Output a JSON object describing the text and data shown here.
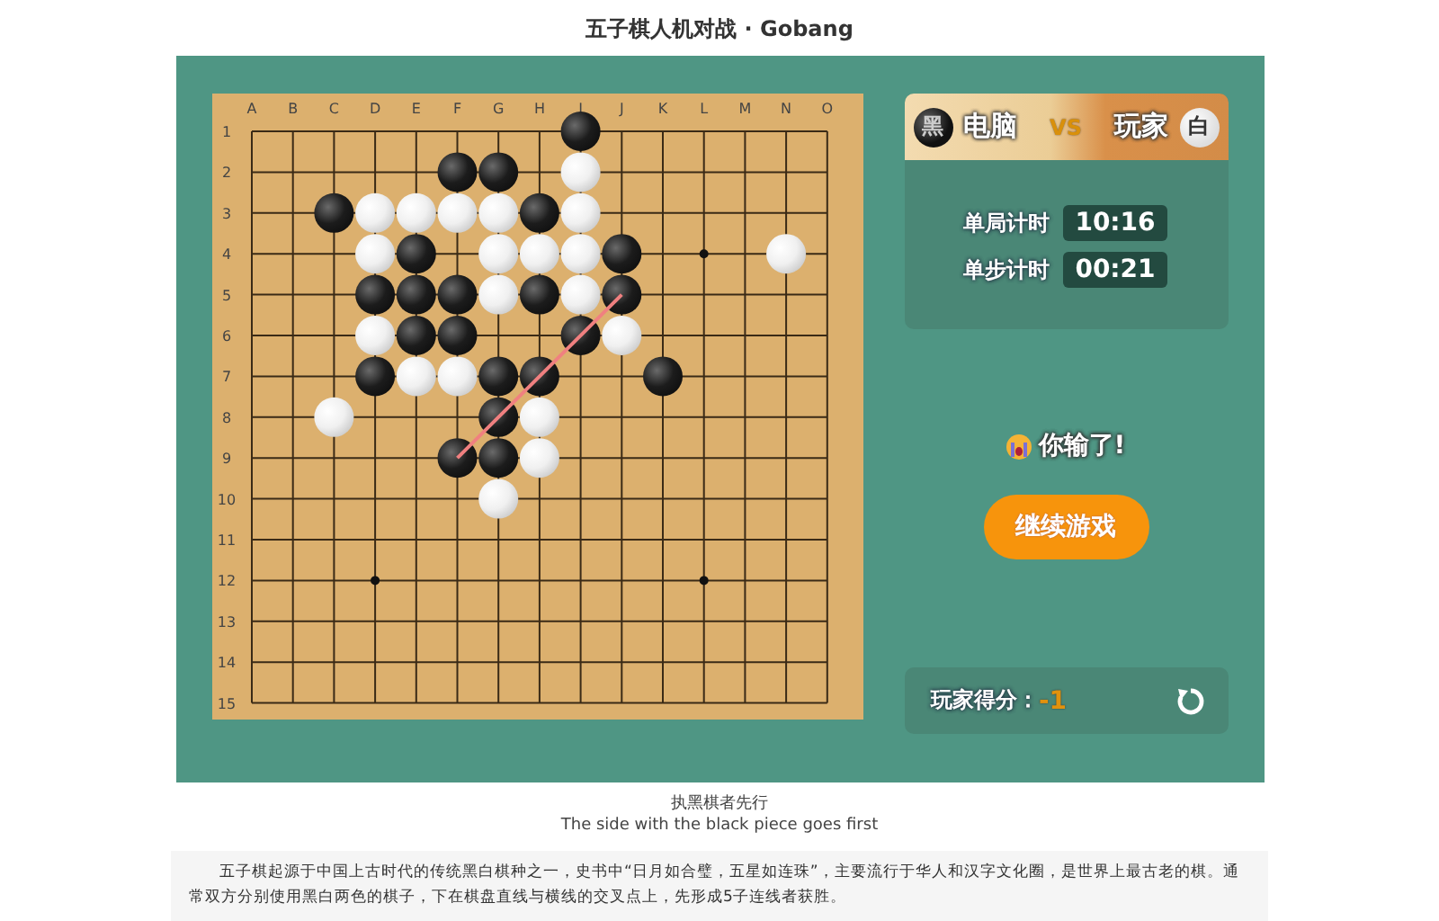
{
  "page_title": "五子棋人机对战 · Gobang",
  "board": {
    "columns": [
      "A",
      "B",
      "C",
      "D",
      "E",
      "F",
      "G",
      "H",
      "I",
      "J",
      "K",
      "L",
      "M",
      "N",
      "O"
    ],
    "rows": [
      "1",
      "2",
      "3",
      "4",
      "5",
      "6",
      "7",
      "8",
      "9",
      "10",
      "11",
      "12",
      "13",
      "14",
      "15"
    ],
    "grid": [
      [
        {
          "kind": "empty"
        },
        {
          "kind": "empty"
        },
        {
          "kind": "empty"
        },
        {
          "kind": "empty"
        },
        {
          "kind": "empty"
        },
        {
          "kind": "empty"
        },
        {
          "kind": "empty"
        },
        {
          "kind": "empty"
        },
        {
          "kind": "black"
        },
        {
          "kind": "empty"
        },
        {
          "kind": "empty"
        },
        {
          "kind": "empty"
        },
        {
          "kind": "empty"
        },
        {
          "kind": "empty"
        },
        {
          "kind": "empty"
        }
      ],
      [
        {
          "kind": "empty"
        },
        {
          "kind": "empty"
        },
        {
          "kind": "empty"
        },
        {
          "kind": "empty"
        },
        {
          "kind": "empty"
        },
        {
          "kind": "black"
        },
        {
          "kind": "black"
        },
        {
          "kind": "empty"
        },
        {
          "kind": "white"
        },
        {
          "kind": "empty"
        },
        {
          "kind": "empty"
        },
        {
          "kind": "empty"
        },
        {
          "kind": "empty"
        },
        {
          "kind": "empty"
        },
        {
          "kind": "empty"
        }
      ],
      [
        {
          "kind": "empty"
        },
        {
          "kind": "empty"
        },
        {
          "kind": "black"
        },
        {
          "kind": "white"
        },
        {
          "kind": "white"
        },
        {
          "kind": "white"
        },
        {
          "kind": "white"
        },
        {
          "kind": "black"
        },
        {
          "kind": "white"
        },
        {
          "kind": "empty"
        },
        {
          "kind": "empty"
        },
        {
          "kind": "empty"
        },
        {
          "kind": "empty"
        },
        {
          "kind": "empty"
        },
        {
          "kind": "empty"
        }
      ],
      [
        {
          "kind": "empty"
        },
        {
          "kind": "empty"
        },
        {
          "kind": "empty"
        },
        {
          "kind": "white"
        },
        {
          "kind": "black"
        },
        {
          "kind": "empty"
        },
        {
          "kind": "white"
        },
        {
          "kind": "white"
        },
        {
          "kind": "white"
        },
        {
          "kind": "black"
        },
        {
          "kind": "empty"
        },
        {
          "kind": "empty"
        },
        {
          "kind": "empty"
        },
        {
          "kind": "white"
        },
        {
          "kind": "empty"
        }
      ],
      [
        {
          "kind": "empty"
        },
        {
          "kind": "empty"
        },
        {
          "kind": "empty"
        },
        {
          "kind": "black"
        },
        {
          "kind": "black"
        },
        {
          "kind": "black"
        },
        {
          "kind": "white"
        },
        {
          "kind": "black"
        },
        {
          "kind": "white"
        },
        {
          "kind": "black",
          "winning": true
        },
        {
          "kind": "empty"
        },
        {
          "kind": "empty"
        },
        {
          "kind": "empty"
        },
        {
          "kind": "empty"
        },
        {
          "kind": "empty"
        }
      ],
      [
        {
          "kind": "empty"
        },
        {
          "kind": "empty"
        },
        {
          "kind": "empty"
        },
        {
          "kind": "white"
        },
        {
          "kind": "black"
        },
        {
          "kind": "black"
        },
        {
          "kind": "empty"
        },
        {
          "kind": "empty"
        },
        {
          "kind": "black",
          "winning": true
        },
        {
          "kind": "white"
        },
        {
          "kind": "empty"
        },
        {
          "kind": "empty"
        },
        {
          "kind": "empty"
        },
        {
          "kind": "empty"
        },
        {
          "kind": "empty"
        }
      ],
      [
        {
          "kind": "empty"
        },
        {
          "kind": "empty"
        },
        {
          "kind": "empty"
        },
        {
          "kind": "black"
        },
        {
          "kind": "white"
        },
        {
          "kind": "white"
        },
        {
          "kind": "black"
        },
        {
          "kind": "black",
          "winning": true
        },
        {
          "kind": "empty"
        },
        {
          "kind": "empty"
        },
        {
          "kind": "black"
        },
        {
          "kind": "empty"
        },
        {
          "kind": "empty"
        },
        {
          "kind": "empty"
        },
        {
          "kind": "empty"
        }
      ],
      [
        {
          "kind": "empty"
        },
        {
          "kind": "empty"
        },
        {
          "kind": "white"
        },
        {
          "kind": "empty"
        },
        {
          "kind": "empty"
        },
        {
          "kind": "empty"
        },
        {
          "kind": "black",
          "winning": true
        },
        {
          "kind": "white"
        },
        {
          "kind": "empty"
        },
        {
          "kind": "empty"
        },
        {
          "kind": "empty"
        },
        {
          "kind": "empty"
        },
        {
          "kind": "empty"
        },
        {
          "kind": "empty"
        },
        {
          "kind": "empty"
        }
      ],
      [
        {
          "kind": "empty"
        },
        {
          "kind": "empty"
        },
        {
          "kind": "empty"
        },
        {
          "kind": "empty"
        },
        {
          "kind": "empty"
        },
        {
          "kind": "black",
          "winning": true
        },
        {
          "kind": "black"
        },
        {
          "kind": "white"
        },
        {
          "kind": "empty"
        },
        {
          "kind": "empty"
        },
        {
          "kind": "empty"
        },
        {
          "kind": "empty"
        },
        {
          "kind": "empty"
        },
        {
          "kind": "empty"
        },
        {
          "kind": "empty"
        }
      ],
      [
        {
          "kind": "empty"
        },
        {
          "kind": "empty"
        },
        {
          "kind": "empty"
        },
        {
          "kind": "empty"
        },
        {
          "kind": "empty"
        },
        {
          "kind": "empty"
        },
        {
          "kind": "white"
        },
        {
          "kind": "empty"
        },
        {
          "kind": "empty"
        },
        {
          "kind": "empty"
        },
        {
          "kind": "empty"
        },
        {
          "kind": "empty"
        },
        {
          "kind": "empty"
        },
        {
          "kind": "empty"
        },
        {
          "kind": "empty"
        }
      ],
      [
        {
          "kind": "empty"
        },
        {
          "kind": "empty"
        },
        {
          "kind": "empty"
        },
        {
          "kind": "empty"
        },
        {
          "kind": "empty"
        },
        {
          "kind": "empty"
        },
        {
          "kind": "empty"
        },
        {
          "kind": "empty"
        },
        {
          "kind": "empty"
        },
        {
          "kind": "empty"
        },
        {
          "kind": "empty"
        },
        {
          "kind": "empty"
        },
        {
          "kind": "empty"
        },
        {
          "kind": "empty"
        },
        {
          "kind": "empty"
        }
      ],
      [
        {
          "kind": "empty"
        },
        {
          "kind": "empty"
        },
        {
          "kind": "empty"
        },
        {
          "kind": "empty"
        },
        {
          "kind": "empty"
        },
        {
          "kind": "empty"
        },
        {
          "kind": "empty"
        },
        {
          "kind": "empty"
        },
        {
          "kind": "empty"
        },
        {
          "kind": "empty"
        },
        {
          "kind": "empty"
        },
        {
          "kind": "empty"
        },
        {
          "kind": "empty"
        },
        {
          "kind": "empty"
        },
        {
          "kind": "empty"
        }
      ],
      [
        {
          "kind": "empty"
        },
        {
          "kind": "empty"
        },
        {
          "kind": "empty"
        },
        {
          "kind": "empty"
        },
        {
          "kind": "empty"
        },
        {
          "kind": "empty"
        },
        {
          "kind": "empty"
        },
        {
          "kind": "empty"
        },
        {
          "kind": "empty"
        },
        {
          "kind": "empty"
        },
        {
          "kind": "empty"
        },
        {
          "kind": "empty"
        },
        {
          "kind": "empty"
        },
        {
          "kind": "empty"
        },
        {
          "kind": "empty"
        }
      ],
      [
        {
          "kind": "empty"
        },
        {
          "kind": "empty"
        },
        {
          "kind": "empty"
        },
        {
          "kind": "empty"
        },
        {
          "kind": "empty"
        },
        {
          "kind": "empty"
        },
        {
          "kind": "empty"
        },
        {
          "kind": "empty"
        },
        {
          "kind": "empty"
        },
        {
          "kind": "empty"
        },
        {
          "kind": "empty"
        },
        {
          "kind": "empty"
        },
        {
          "kind": "empty"
        },
        {
          "kind": "empty"
        },
        {
          "kind": "empty"
        }
      ],
      [
        {
          "kind": "empty"
        },
        {
          "kind": "empty"
        },
        {
          "kind": "empty"
        },
        {
          "kind": "empty"
        },
        {
          "kind": "empty"
        },
        {
          "kind": "empty"
        },
        {
          "kind": "empty"
        },
        {
          "kind": "empty"
        },
        {
          "kind": "empty"
        },
        {
          "kind": "empty"
        },
        {
          "kind": "empty"
        },
        {
          "kind": "empty"
        },
        {
          "kind": "empty"
        },
        {
          "kind": "empty"
        },
        {
          "kind": "empty"
        }
      ]
    ]
  },
  "players": {
    "left": {
      "stone": "黑",
      "name": "电脑",
      "kind": "black"
    },
    "vs": "VS",
    "right": {
      "name": "玩家",
      "stone": "白",
      "kind": "white"
    }
  },
  "timers": [
    {
      "label": "单局计时",
      "value": "10:16"
    },
    {
      "label": "单步计时",
      "value": "00:21"
    }
  ],
  "result_message": "你输了!",
  "continue_button": "继续游戏",
  "score": {
    "label": "玩家得分：",
    "value": "-1"
  },
  "caption": {
    "chinese": "执黑棋者先行",
    "english": "The side with the black piece goes first"
  },
  "description": "五子棋起源于中国上古时代的传统黑白棋种之一，史书中“日月如合璧，五星如连珠”，主要流行于华人和汉字文化圈，是世界上最古老的棋。通常双方分别使用黑白两色的棋子，下在棋盘直线与横线的交叉点上，先形成5子连线者获胜。"
}
